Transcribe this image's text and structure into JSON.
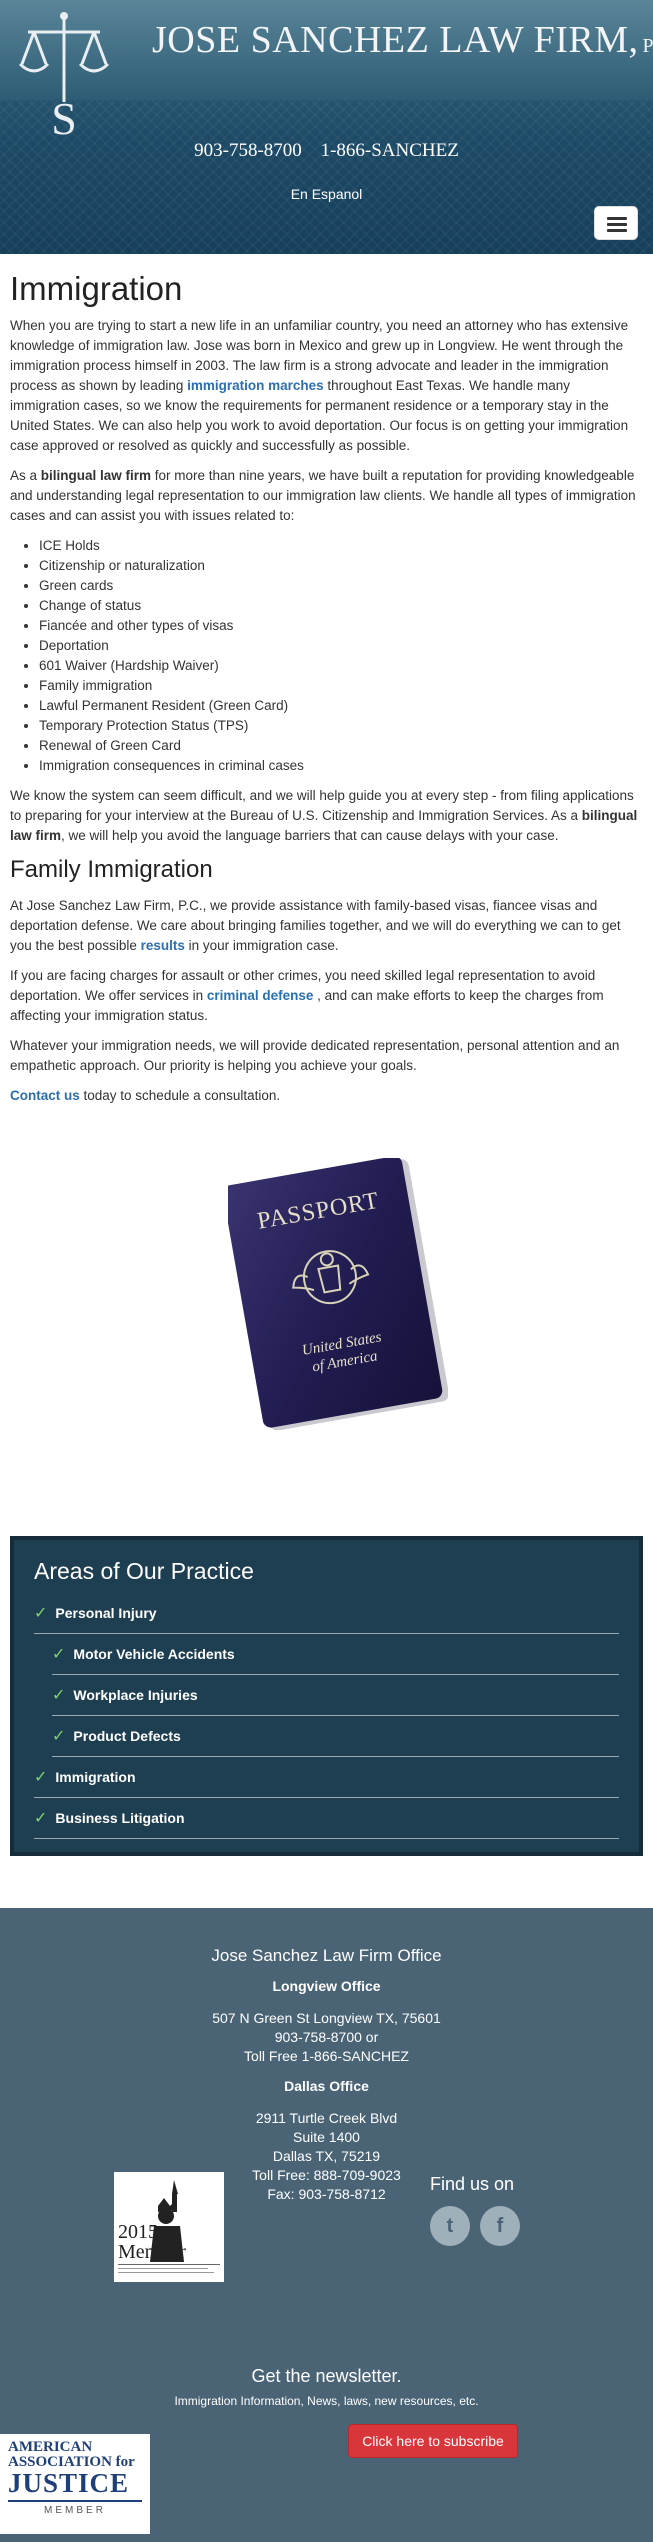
{
  "header": {
    "firm_name": "JOSE SANCHEZ LAW FIRM,",
    "firm_suffix": "P.C.",
    "phone_1": "903-758-8700",
    "phone_2": "1-866-SANCHEZ",
    "language_link": "En Espanol",
    "menu_icon": "hamburger-menu-icon"
  },
  "main": {
    "title": "Immigration",
    "intro": {
      "before": "When you are trying to start a new life in an unfamiliar country, you need an attorney who has extensive knowledge of immigration law. Jose was born in Mexico and grew up in Longview. He went through the immigration process himself in 2003. The law firm is a strong advocate and leader in the immigration process as shown by leading ",
      "link": "immigration marches",
      "after": " throughout East Texas. We handle many immigration cases, so we know the requirements for permanent residence or a temporary stay in the United States. We can also help you work to avoid deportation. Our focus is on getting your immigration case approved or resolved as quickly and successfully as possible."
    },
    "para2": {
      "before": "As a ",
      "bold": "bilingual law firm",
      "after": " for more than nine years, we have built a reputation for providing knowledgeable and understanding legal representation to our immigration law clients. We handle all types of immigration cases and can assist you with issues related to:"
    },
    "issues": [
      "ICE Holds",
      "Citizenship or naturalization",
      "Green cards",
      "Change of status",
      "Fiancée and other types of visas",
      "Deportation",
      "601 Waiver (Hardship Waiver)",
      "Family immigration",
      "Lawful Permanent Resident (Green Card)",
      "Temporary Protection Status (TPS)",
      "Renewal of Green Card",
      "Immigration consequences in criminal cases"
    ],
    "para3": {
      "before": "We know the system can seem difficult, and we will help guide you at every step - from filing applications to preparing for your interview at the Bureau of U.S. Citizenship and Immigration Services. As a ",
      "bold": "bilingual law firm",
      "after": ", we will help you avoid the language barriers that can cause delays with your case."
    },
    "family_title": "Family Immigration",
    "family_para": {
      "before": "At Jose Sanchez Law Firm, P.C., we provide assistance with family-based visas, fiancee visas and deportation defense. We care about bringing families together, and we will do everything we can to get you the best possible ",
      "link": "results",
      "after": " in your immigration case."
    },
    "criminal_para": {
      "before": "If you are facing charges for assault or other crimes, you need skilled legal representation to avoid deportation. We offer services in ",
      "link": "criminal defense",
      "after": " , and can make efforts to keep the charges from affecting your immigration status."
    },
    "whatever_para": "Whatever your immigration needs, we will provide dedicated representation, personal attention and an empathetic approach. Our priority is helping you achieve your goals.",
    "contact": {
      "link": "Contact us",
      "after": " today to schedule a consultation."
    },
    "passport": {
      "line1": "PASSPORT",
      "line2": "United States",
      "line3": "of America"
    }
  },
  "areas": {
    "title": "Areas of Our Practice",
    "items": [
      {
        "label": "Personal Injury",
        "sub": false
      },
      {
        "label": "Motor Vehicle Accidents",
        "sub": true
      },
      {
        "label": "Workplace Injuries",
        "sub": true
      },
      {
        "label": "Product Defects",
        "sub": true
      },
      {
        "label": "Immigration",
        "sub": false
      },
      {
        "label": "Business Litigation",
        "sub": false
      }
    ]
  },
  "footer": {
    "office_title": "Jose Sanchez Law Firm Office",
    "longview": {
      "title": "Longview Office",
      "address": "507 N Green St Longview TX, 75601",
      "phone": "903-758-8700 or",
      "tollfree": "Toll Free 1-866-SANCHEZ"
    },
    "dallas": {
      "title": "Dallas Office",
      "street": "2911 Turtle Creek Blvd",
      "suite": "Suite 1400",
      "city": "Dallas TX, 75219",
      "tollfree": "Toll Free: 888-709-9023",
      "fax": "Fax: 903-758-8712"
    },
    "badge": {
      "year": "2015",
      "label": "Member"
    },
    "find_us": "Find us on",
    "social": [
      {
        "icon": "twitter-icon",
        "glyph": "t"
      },
      {
        "icon": "facebook-icon",
        "glyph": "f"
      }
    ],
    "newsletter_title": "Get the newsletter.",
    "newsletter_sub": "Immigration Information, News, laws, new resources, etc.",
    "subscribe": "Click here to subscribe",
    "aaj": {
      "line1": "AMERICAN",
      "line2": "ASSOCIATION for",
      "line3": "JUSTICE",
      "line4": "MEMBER"
    }
  },
  "colors": {
    "header_dark": "#163f5a",
    "link": "#2a6fb0",
    "areas_bg": "#1e3f52",
    "check": "#7ed36c",
    "footer_bg": "#4a6476",
    "subscribe": "#d9363b"
  }
}
